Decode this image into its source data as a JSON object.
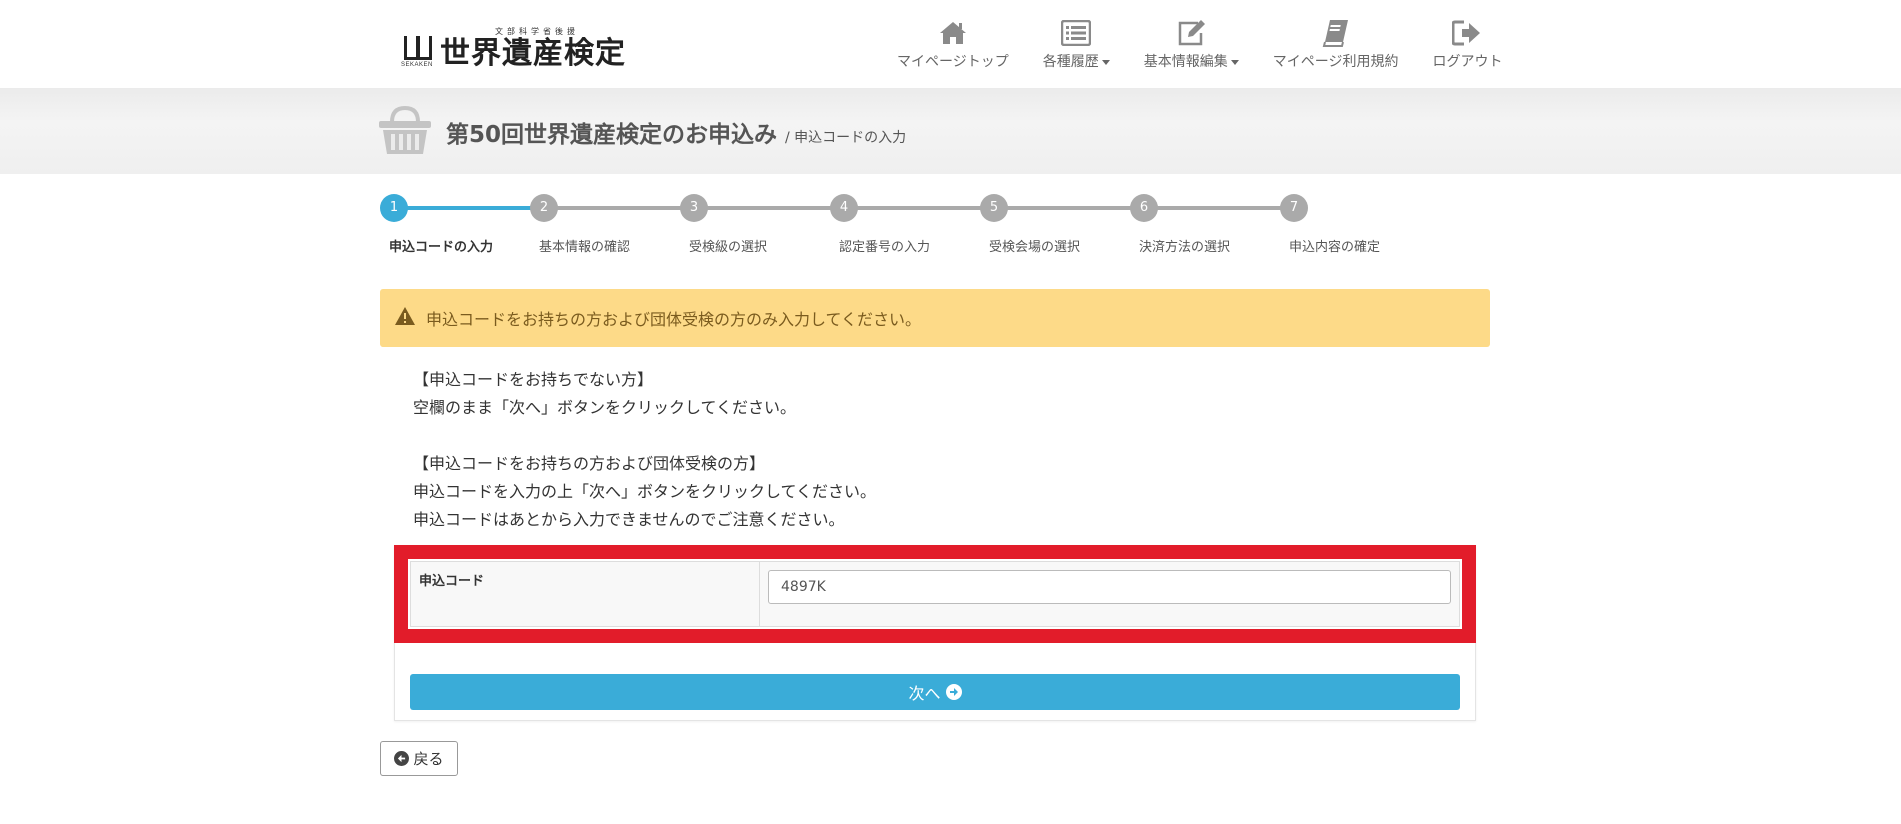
{
  "brand": {
    "logo_subtitle": "文部科学省後援",
    "logo_mark_text": "SEKAKEN",
    "logo_title": "世界遺産検定"
  },
  "nav": {
    "items": [
      {
        "label": "マイページトップ",
        "icon": "home-icon"
      },
      {
        "label": "各種履歴",
        "icon": "list-icon",
        "dropdown": true
      },
      {
        "label": "基本情報編集",
        "icon": "edit-icon",
        "dropdown": true
      },
      {
        "label": "マイページ利用規約",
        "icon": "book-icon"
      },
      {
        "label": "ログアウト",
        "icon": "logout-icon"
      }
    ]
  },
  "page": {
    "title": "第50回世界遺産検定のお申込み",
    "subtitle": "/ 申込コードの入力"
  },
  "steps": [
    {
      "number": "1",
      "label": "申込コードの入力",
      "active": true
    },
    {
      "number": "2",
      "label": "基本情報の確認",
      "active": false
    },
    {
      "number": "3",
      "label": "受検級の選択",
      "active": false
    },
    {
      "number": "4",
      "label": "認定番号の入力",
      "active": false
    },
    {
      "number": "5",
      "label": "受検会場の選択",
      "active": false
    },
    {
      "number": "6",
      "label": "決済方法の選択",
      "active": false
    },
    {
      "number": "7",
      "label": "申込内容の確定",
      "active": false
    }
  ],
  "alert": {
    "text": "申込コードをお持ちの方および団体受検の方のみ入力してください。",
    "icon": "warning-icon"
  },
  "instructions": {
    "no_code_heading": "【申込コードをお持ちでない方】",
    "no_code_text": "空欄のまま「次へ」ボタンをクリックしてください。",
    "code_heading": "【申込コードをお持ちの方および団体受検の方】",
    "code_text_1": "申込コードを入力の上「次へ」ボタンをクリックしてください。",
    "code_text_2": "申込コードはあとから入力できませんのでご注意ください。"
  },
  "form": {
    "code_label": "申込コード",
    "code_value": "4897K"
  },
  "buttons": {
    "next_label": "次へ",
    "back_label": "戻る"
  },
  "colors": {
    "accent": "#3aacd8",
    "alert_bg": "#fdda88",
    "highlight": "#e21c2a",
    "step_inactive": "#aaaaaa"
  }
}
